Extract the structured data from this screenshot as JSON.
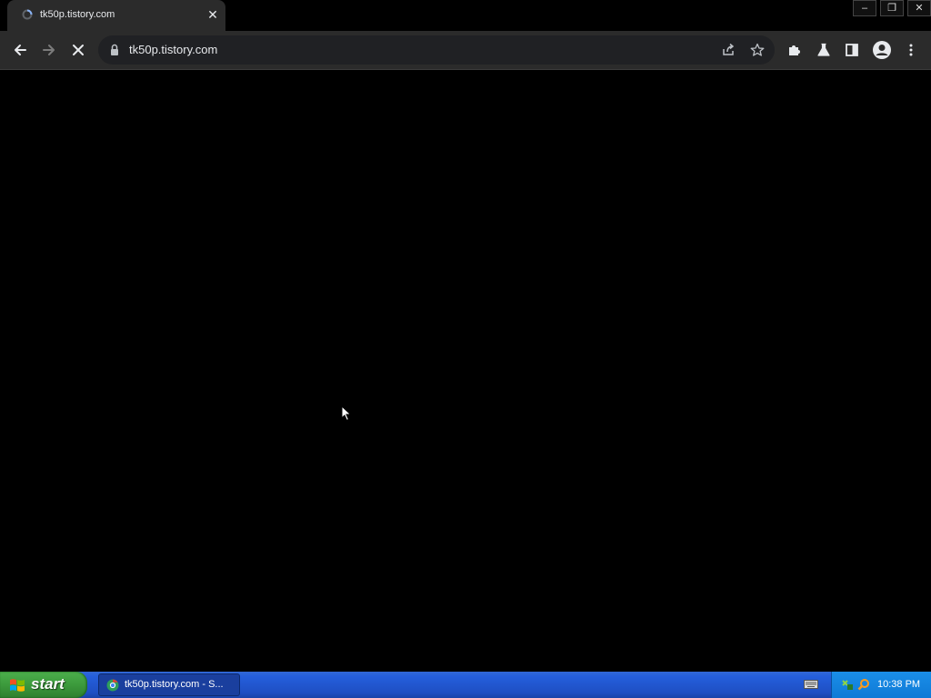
{
  "browser": {
    "tab": {
      "title": "tk50p.tistory.com",
      "close": "✕"
    },
    "window_controls": {
      "minimize": "–",
      "restore": "❐",
      "close": "✕"
    },
    "omnibox": {
      "url": "tk50p.tistory.com"
    },
    "icons": [
      "back-icon",
      "forward-icon",
      "stop-icon",
      "lock-icon",
      "share-icon",
      "star-icon",
      "extensions-icon",
      "labs-icon",
      "side-panel-icon",
      "profile-icon",
      "menu-icon"
    ]
  },
  "taskbar": {
    "start_label": "start",
    "task_item_label": "tk50p.tistory.com - S...",
    "clock": "10:38 PM"
  },
  "colors": {
    "chrome_dark": "#2b2b2b",
    "omnibox": "#202124",
    "taskbar_blue": "#245edb",
    "start_green": "#3c9a3c"
  }
}
